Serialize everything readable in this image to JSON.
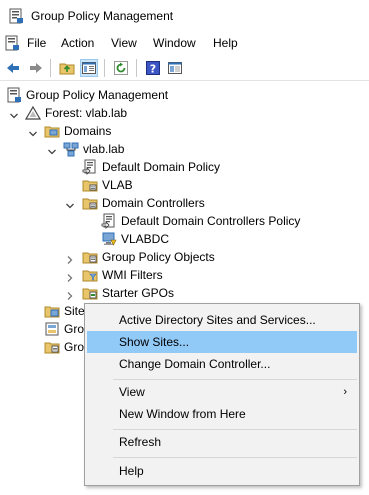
{
  "window": {
    "title": "Group Policy Management"
  },
  "menubar": {
    "items": [
      "File",
      "Action",
      "View",
      "Window",
      "Help"
    ]
  },
  "toolbar": {
    "buttons": [
      "back-icon",
      "forward-icon",
      "up-folder-icon",
      "show-hide-tree-icon",
      "refresh-icon",
      "help-icon",
      "properties-icon"
    ]
  },
  "tree": {
    "root": "Group Policy Management",
    "forest": "Forest: vlab.lab",
    "domains": "Domains",
    "domain": "vlab.lab",
    "default_domain_policy": "Default Domain Policy",
    "vlab_ou": "VLAB",
    "domain_controllers": "Domain Controllers",
    "default_dc_policy": "Default Domain Controllers Policy",
    "vlabdc": "VLABDC",
    "gpo": "Group Policy Objects",
    "wmi": "WMI Filters",
    "starter": "Starter GPOs",
    "sites": "Sites",
    "gro1": "Gro",
    "gro2": "Gro"
  },
  "context_menu": {
    "items": [
      "Active Directory Sites and Services...",
      "Show Sites...",
      "Change Domain Controller...",
      "View",
      "New Window from Here",
      "Refresh",
      "Help"
    ],
    "highlighted": "Show Sites..."
  },
  "colors": {
    "highlight": "#91c9f7",
    "folder": "#e8c46a",
    "accent": "#2f6fb5"
  }
}
